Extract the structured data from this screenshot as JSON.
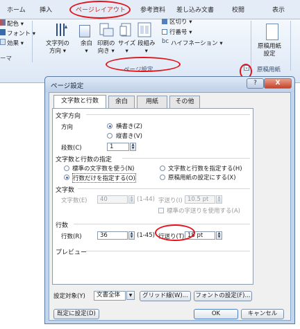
{
  "ribbon": {
    "tabs": [
      "ホーム",
      "挿入",
      "ページレイアウト",
      "参考資料",
      "差し込み文書",
      "校閲",
      "表示"
    ],
    "theme_items": [
      "配色 ▾",
      "フォント ▾",
      "効果 ▾"
    ],
    "theme_group": "ーマ",
    "buttons": {
      "text_direction": "文字列の\n方向 ▾",
      "margins": "余白\n▾",
      "orientation": "印刷の\n向き ▾",
      "size": "サイズ\n▾",
      "columns": "段組み\n▾",
      "breaks": "区切り ▾",
      "line_numbers": "行番号 ▾",
      "hyphenation": "ハイフネーション ▾",
      "manuscript": "原稿用紙\n設定"
    },
    "page_setup_group": "ページ設定",
    "manuscript_group": "原稿用紙",
    "launcher": "⌄"
  },
  "dialog": {
    "title": "ページ設定",
    "help": "?",
    "close": "X",
    "tabs": [
      "文字数と行数",
      "余白",
      "用紙",
      "その他"
    ],
    "text_direction": {
      "group": "文字方向",
      "direction_label": "方向",
      "horizontal": "横書き(Z)",
      "vertical": "縦書き(V)",
      "columns_label": "段数(C)",
      "columns_value": "1"
    },
    "char_line_spec": {
      "group": "文字数と行数の指定",
      "opt_standard": "標準の文字数を使う(N)",
      "opt_lines_only": "行数だけを指定する(O)",
      "opt_both": "文字数と行数を指定する(H)",
      "opt_manuscript": "原稿用紙の設定にする(X)"
    },
    "chars": {
      "group": "文字数",
      "count_label": "文字数(E)",
      "count_value": "40",
      "range": "(1-44)",
      "pitch_label": "字送り(I)",
      "pitch_value": "10.5 pt",
      "standard_pitch": "標準の字送りを使用する(A)"
    },
    "lines": {
      "group": "行数",
      "count_label": "行数(R)",
      "count_value": "36",
      "range": "(1-45)",
      "pitch_label": "行送り(T)",
      "pitch_value": "18 pt"
    },
    "preview": {
      "group": "プレビュー"
    },
    "apply_label": "設定対象(Y)",
    "apply_value": "文書全体",
    "grid_button": "グリッド線(W)...",
    "font_button": "フォントの設定(F)...",
    "default_button": "既定に設定(D)",
    "ok_button": "OK",
    "cancel_button": "キャンセル"
  },
  "colors": {
    "highlight": "#e1141b",
    "dialog_frame": "#c3d5ea",
    "ribbon_bg": "#dce7f5"
  }
}
